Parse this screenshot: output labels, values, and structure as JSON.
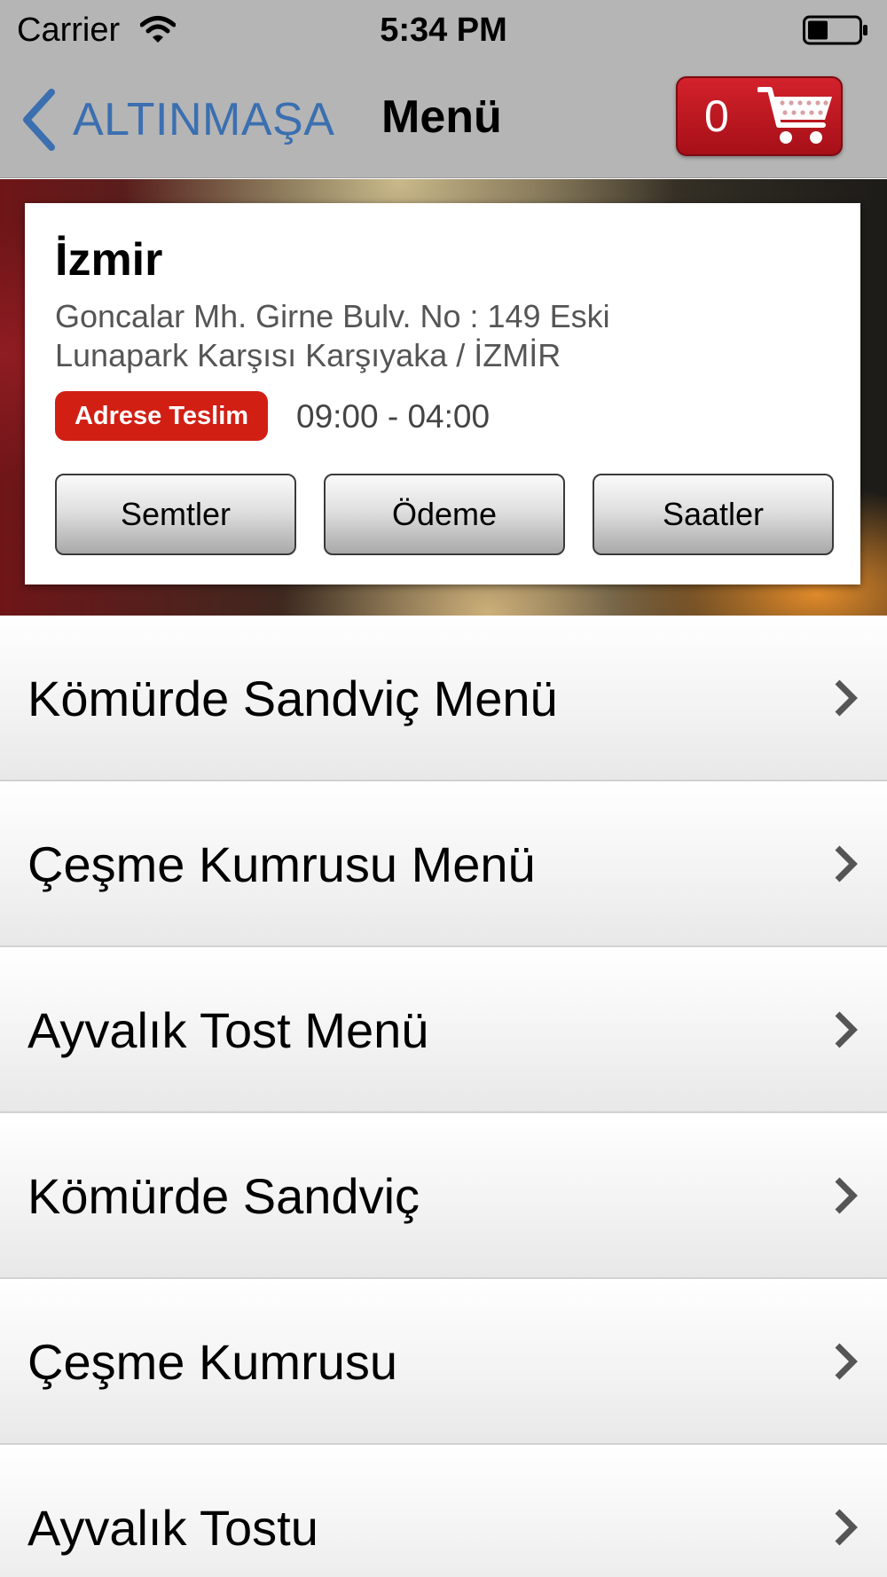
{
  "status_bar": {
    "carrier": "Carrier",
    "time": "5:34 PM"
  },
  "nav": {
    "back_label": "ALTINMAŞA",
    "title": "Menü",
    "cart_count": "0"
  },
  "store": {
    "city": "İzmir",
    "address_line1": "Goncalar Mh. Girne Bulv.  No : 149 Eski",
    "address_line2": "Lunapark Karşısı Karşıyaka / İZMİR",
    "badge": "Adrese Teslim",
    "hours": "09:00 - 04:00",
    "buttons": [
      "Semtler",
      "Ödeme",
      "Saatler"
    ]
  },
  "menu": {
    "items": [
      {
        "label": "Kömürde Sandviç Menü"
      },
      {
        "label": "Çeşme Kumrusu Menü"
      },
      {
        "label": "Ayvalık Tost Menü"
      },
      {
        "label": "Kömürde Sandviç"
      },
      {
        "label": "Çeşme Kumrusu"
      },
      {
        "label": "Ayvalık Tostu"
      }
    ]
  },
  "colors": {
    "back_link": "#3b6fb0",
    "cart_red": "#c21a22",
    "badge_red": "#d21f14"
  }
}
